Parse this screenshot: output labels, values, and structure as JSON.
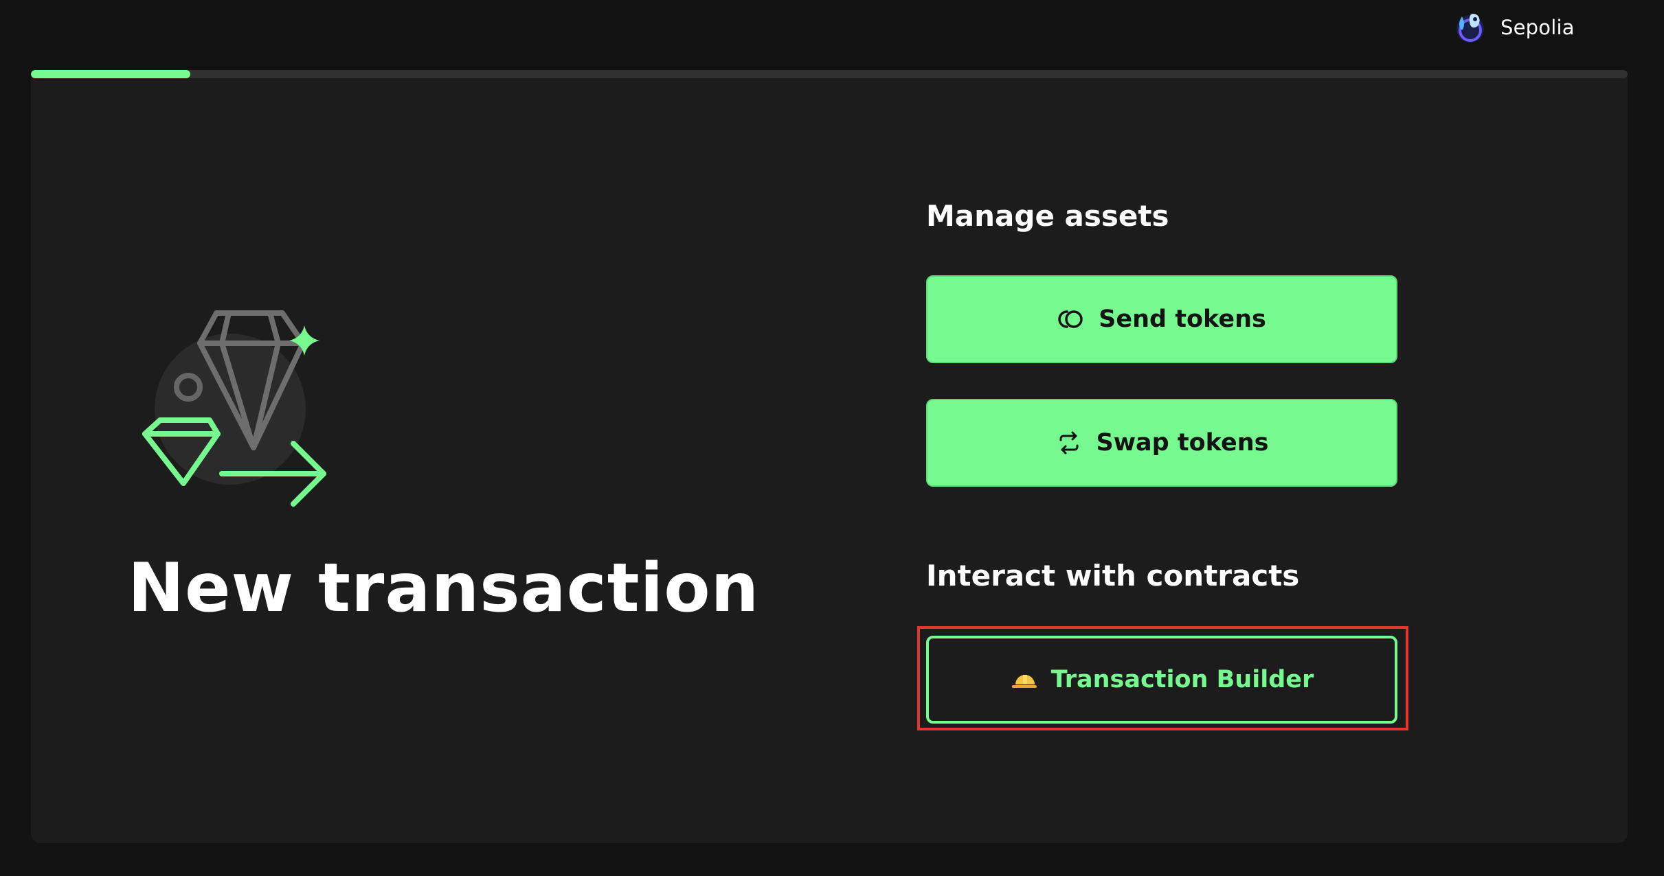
{
  "network": {
    "name": "Sepolia",
    "icon": "sepolia-network-icon"
  },
  "progress": {
    "percent": 10,
    "color": "#76fa8f"
  },
  "main": {
    "title": "New transaction",
    "illustration_icon": "diamond-transfer-illustration"
  },
  "manage_assets": {
    "heading": "Manage assets",
    "send_label": "Send tokens",
    "send_icon": "tokens-icon",
    "swap_label": "Swap tokens",
    "swap_icon": "swap-arrows-icon"
  },
  "contracts": {
    "heading": "Interact with contracts",
    "builder_label": "Transaction Builder",
    "builder_icon": "hard-hat-icon"
  },
  "colors": {
    "accent": "#76fa8f",
    "background": "#121212",
    "card": "#1c1c1c",
    "highlight": "#e3362e"
  }
}
